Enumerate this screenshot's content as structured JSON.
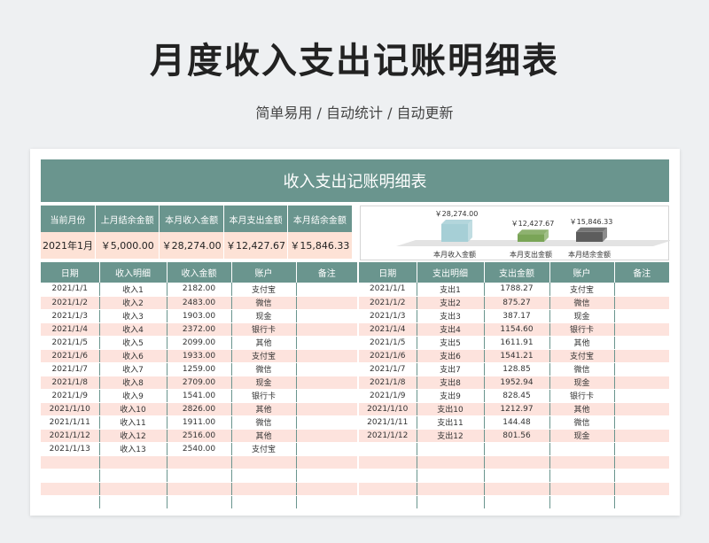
{
  "header": {
    "title": "月度收入支出记账明细表",
    "subtitle": "简单易用 / 自动统计 / 自动更新"
  },
  "sheet": {
    "banner": "收入支出记账明细表",
    "summary": {
      "headers": [
        "当前月份",
        "上月结余金额",
        "本月收入金额",
        "本月支出金额",
        "本月结余金额"
      ],
      "values": [
        "2021年1月",
        "￥5,000.00",
        "￥28,274.00",
        "￥12,427.67",
        "￥15,846.33"
      ]
    },
    "colors": {
      "accent": "#6a958e",
      "row_tint": "#fde3dd",
      "summary_tint": "#fde2d6"
    },
    "chart_data": {
      "type": "bar",
      "categories": [
        "本月收入金额",
        "本月支出金额",
        "本月结余金额"
      ],
      "values": [
        28274.0,
        12427.67,
        15846.33
      ],
      "data_labels": [
        "￥28,274.00",
        "￥12,427.67",
        "￥15,846.33"
      ],
      "colors": [
        "#a6cfd6",
        "#7aa557",
        "#5d5d5d"
      ],
      "legend": "none",
      "grid": false
    },
    "income": {
      "headers": [
        "日期",
        "收入明细",
        "收入金额",
        "账户",
        "备注"
      ],
      "rows": [
        [
          "2021/1/1",
          "收入1",
          "2182.00",
          "支付宝",
          ""
        ],
        [
          "2021/1/2",
          "收入2",
          "2483.00",
          "微信",
          ""
        ],
        [
          "2021/1/3",
          "收入3",
          "1903.00",
          "现金",
          ""
        ],
        [
          "2021/1/4",
          "收入4",
          "2372.00",
          "银行卡",
          ""
        ],
        [
          "2021/1/5",
          "收入5",
          "2099.00",
          "其他",
          ""
        ],
        [
          "2021/1/6",
          "收入6",
          "1933.00",
          "支付宝",
          ""
        ],
        [
          "2021/1/7",
          "收入7",
          "1259.00",
          "微信",
          ""
        ],
        [
          "2021/1/8",
          "收入8",
          "2709.00",
          "现金",
          ""
        ],
        [
          "2021/1/9",
          "收入9",
          "1541.00",
          "银行卡",
          ""
        ],
        [
          "2021/1/10",
          "收入10",
          "2826.00",
          "其他",
          ""
        ],
        [
          "2021/1/11",
          "收入11",
          "1911.00",
          "微信",
          ""
        ],
        [
          "2021/1/12",
          "收入12",
          "2516.00",
          "其他",
          ""
        ],
        [
          "2021/1/13",
          "收入13",
          "2540.00",
          "支付宝",
          ""
        ],
        [
          "",
          "",
          "",
          "",
          ""
        ],
        [
          "",
          "",
          "",
          "",
          ""
        ],
        [
          "",
          "",
          "",
          "",
          ""
        ],
        [
          "",
          "",
          "",
          "",
          ""
        ]
      ]
    },
    "expense": {
      "headers": [
        "日期",
        "支出明细",
        "支出金额",
        "账户",
        "备注"
      ],
      "rows": [
        [
          "2021/1/1",
          "支出1",
          "1788.27",
          "支付宝",
          ""
        ],
        [
          "2021/1/2",
          "支出2",
          "875.27",
          "微信",
          ""
        ],
        [
          "2021/1/3",
          "支出3",
          "387.17",
          "现金",
          ""
        ],
        [
          "2021/1/4",
          "支出4",
          "1154.60",
          "银行卡",
          ""
        ],
        [
          "2021/1/5",
          "支出5",
          "1611.91",
          "其他",
          ""
        ],
        [
          "2021/1/6",
          "支出6",
          "1541.21",
          "支付宝",
          ""
        ],
        [
          "2021/1/7",
          "支出7",
          "128.85",
          "微信",
          ""
        ],
        [
          "2021/1/8",
          "支出8",
          "1952.94",
          "现金",
          ""
        ],
        [
          "2021/1/9",
          "支出9",
          "828.45",
          "银行卡",
          ""
        ],
        [
          "2021/1/10",
          "支出10",
          "1212.97",
          "其他",
          ""
        ],
        [
          "2021/1/11",
          "支出11",
          "144.48",
          "微信",
          ""
        ],
        [
          "2021/1/12",
          "支出12",
          "801.56",
          "现金",
          ""
        ],
        [
          "",
          "",
          "",
          "",
          ""
        ],
        [
          "",
          "",
          "",
          "",
          ""
        ],
        [
          "",
          "",
          "",
          "",
          ""
        ],
        [
          "",
          "",
          "",
          "",
          ""
        ],
        [
          "",
          "",
          "",
          "",
          ""
        ]
      ]
    }
  }
}
